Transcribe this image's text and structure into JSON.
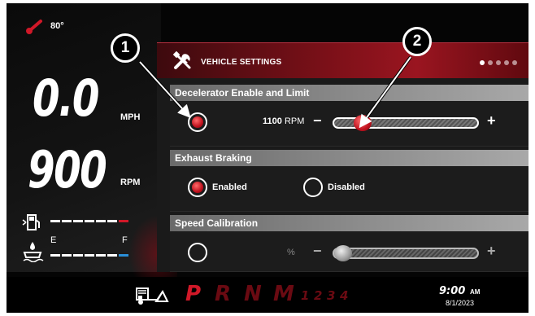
{
  "status": {
    "temperature": "80°",
    "thermometer_color": "#d01828"
  },
  "gauges": {
    "speed_value": "0.0",
    "speed_unit": "MPH",
    "rpm_value": "900",
    "rpm_unit": "RPM",
    "fuel": {
      "icon": "fuel-pump-icon",
      "level": 0.83
    },
    "def": {
      "icon": "def-fluid-icon",
      "empty_label": "E",
      "full_label": "F",
      "level": 0.17
    }
  },
  "settings": {
    "title": "VEHICLE SETTINGS",
    "icon": "wrench-screwdriver-icon",
    "page_count": 5,
    "active_page": 1,
    "sections": {
      "decelerator": {
        "title": "Decelerator Enable and Limit",
        "enabled": true,
        "value": "1100",
        "unit": "RPM",
        "minus": "−",
        "plus": "+"
      },
      "exhaust": {
        "title": "Exhaust Braking",
        "enabled_label": "Enabled",
        "disabled_label": "Disabled",
        "selected": "Enabled"
      },
      "speed_calibration": {
        "title": "Speed Calibration",
        "enabled": false,
        "unit": "%",
        "minus": "−",
        "plus": "+"
      }
    }
  },
  "bottom": {
    "icon": "trailer-brake-icon",
    "gears": [
      "P",
      "R",
      "N",
      "M"
    ],
    "manual_gears": [
      "1",
      "2",
      "3",
      "4"
    ],
    "selected_gear": "P",
    "time": "9:00",
    "ampm": "AM",
    "date": "8/1/2023"
  },
  "callouts": [
    "1",
    "2"
  ],
  "colors": {
    "accent": "#c0121e",
    "header_red": "#9a1520",
    "background": "#050505"
  }
}
